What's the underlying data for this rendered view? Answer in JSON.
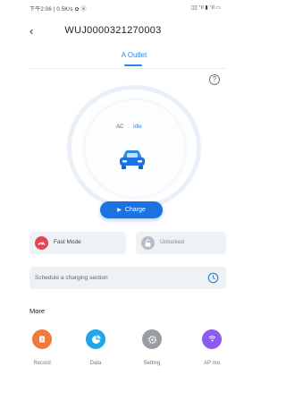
{
  "status_bar": {
    "left_text": "下午2:06 | 0.5K/s ✿ ⓦ",
    "right_text": "▯▯ ᐩıl ▮ ᐩıl ▭"
  },
  "header": {
    "back_icon": "‹",
    "device_id": "WUJ0000321270003"
  },
  "tabs": [
    {
      "label": "A Outlet",
      "active": true
    }
  ],
  "help_icon": "?",
  "status": {
    "type": "AC",
    "state": "Idle"
  },
  "charge_button": {
    "play_icon": "▶",
    "label": "Charge"
  },
  "modes": {
    "fast_mode_label": "Fast Mode",
    "lock_label": "Unlocked"
  },
  "schedule": {
    "label": "Schedule a charging section"
  },
  "more": {
    "title": "More",
    "items": [
      {
        "label": "Record",
        "icon": "record-icon",
        "color": "#f07a3c"
      },
      {
        "label": "Data",
        "icon": "data-icon",
        "color": "#21a6e8"
      },
      {
        "label": "Setting",
        "icon": "gear-icon",
        "color": "#9a9ca3"
      },
      {
        "label": "AP mo",
        "icon": "ap-mode-icon",
        "color": "#8b5cf0"
      }
    ]
  },
  "colors": {
    "accent": "#1c72e0",
    "fast_mode": "#e8434f",
    "card_bg": "#eef1f6"
  }
}
